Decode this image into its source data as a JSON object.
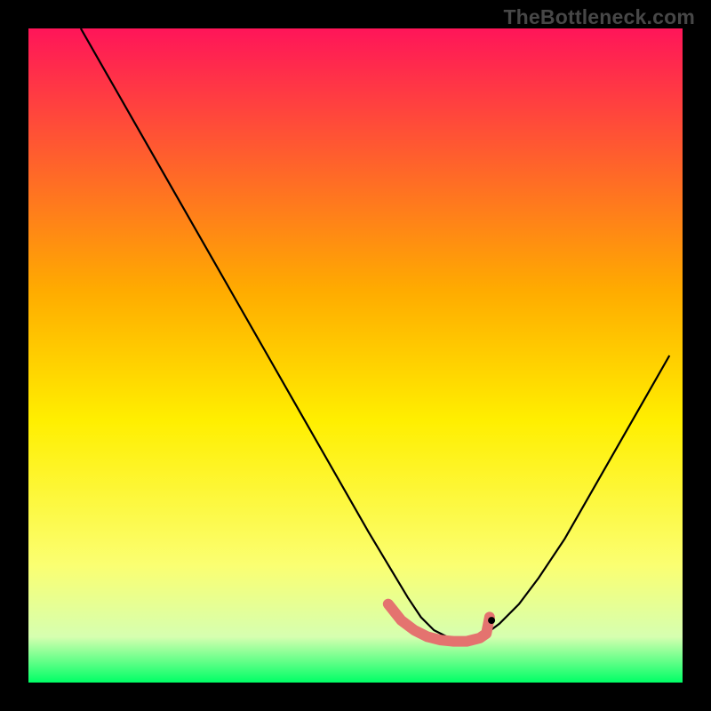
{
  "watermark": "TheBottleneck.com",
  "chart_data": {
    "type": "line",
    "title": "",
    "xlabel": "",
    "ylabel": "",
    "xlim": [
      0,
      100
    ],
    "ylim": [
      0,
      100
    ],
    "gradient_stops": [
      {
        "offset": 0,
        "color": "#ff1559"
      },
      {
        "offset": 40,
        "color": "#ffab00"
      },
      {
        "offset": 60,
        "color": "#ffef00"
      },
      {
        "offset": 82,
        "color": "#fbff71"
      },
      {
        "offset": 93,
        "color": "#d6ffb0"
      },
      {
        "offset": 100,
        "color": "#00ff66"
      }
    ],
    "series": [
      {
        "name": "bottleneck-curve",
        "color": "#000000",
        "stroke_width": 2.2,
        "x": [
          8,
          12,
          16,
          20,
          24,
          28,
          32,
          36,
          40,
          44,
          48,
          52,
          55,
          58,
          60,
          62,
          64,
          66,
          68,
          70,
          72,
          75,
          78,
          82,
          86,
          90,
          94,
          98
        ],
        "y": [
          100,
          93,
          86,
          79,
          72,
          65,
          58,
          51,
          44,
          37,
          30,
          23,
          18,
          13,
          10,
          8,
          7,
          6.5,
          6.5,
          7.5,
          9,
          12,
          16,
          22,
          29,
          36,
          43,
          50
        ]
      },
      {
        "name": "optimal-zone",
        "color": "#e4736f",
        "stroke_width": 12,
        "linecap": "round",
        "x": [
          55,
          57,
          59,
          61,
          63,
          65,
          67,
          69,
          70,
          70.5
        ],
        "y": [
          12,
          9.5,
          8,
          7,
          6.5,
          6.3,
          6.3,
          6.8,
          7.5,
          10
        ]
      }
    ],
    "optimal_marker": {
      "x": 70.8,
      "y": 9.5,
      "color": "#000000",
      "radius": 4
    }
  }
}
